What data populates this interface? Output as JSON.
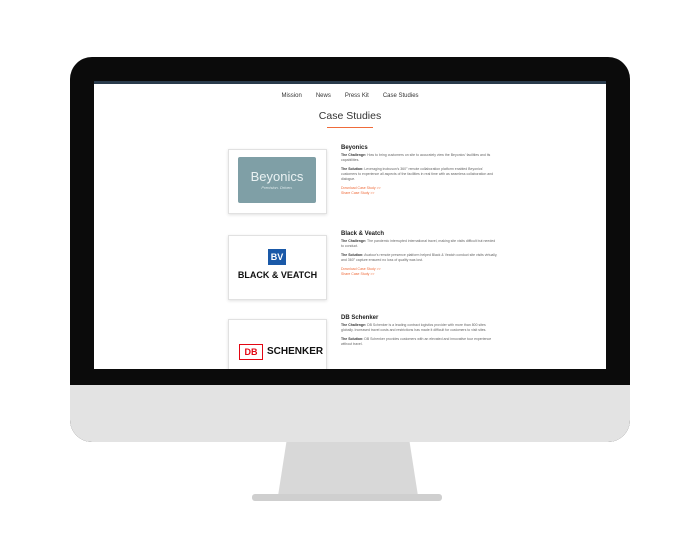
{
  "nav": {
    "items": [
      "Mission",
      "News",
      "Press Kit",
      "Case Studies"
    ]
  },
  "page": {
    "title": "Case Studies"
  },
  "cases": [
    {
      "name": "Beyonics",
      "challenge_label": "The Challenge:",
      "challenge": "How to bring customers on site to accurately view the Beyonics' facilities and its capabilities.",
      "solution_label": "The Solution:",
      "solution": "Leveraging inobuson's 360° remote collaboration platform enabled Beyonics' customers to experience all aspects of the facilities in real time with as seamless collaboration and dialogue.",
      "download": "Download Case Study >>",
      "share": "Share Case Study >>",
      "logo_text": "Beyonics",
      "logo_sub": "Precision. Driven."
    },
    {
      "name": "Black & Veatch",
      "challenge_label": "The Challenge:",
      "challenge": "The pandemic interrupted international travel, making site visits difficult but needed to conduct.",
      "solution_label": "The Solution:",
      "solution": "Avatour's remote presence platform helped Black & Veatch conduct site visits virtually, and 360° capture ensured no loss of quality was lost.",
      "download": "Download Case Study >>",
      "share": "Share Case Study >>",
      "logo_text": "BLACK & VEATCH",
      "logo_mark": "BV"
    },
    {
      "name": "DB Schenker",
      "challenge_label": "The Challenge:",
      "challenge": "DB Schenker is a leading contract logistics provider with more than 800 sites globally. Increased travel costs and restrictions has made it difficult for customers to visit sites.",
      "solution_label": "The Solution:",
      "solution": "DB Schenker provides customers with an elevated and innovative tour experience without travel.",
      "logo_mark": "DB",
      "logo_text": "SCHENKER"
    }
  ]
}
